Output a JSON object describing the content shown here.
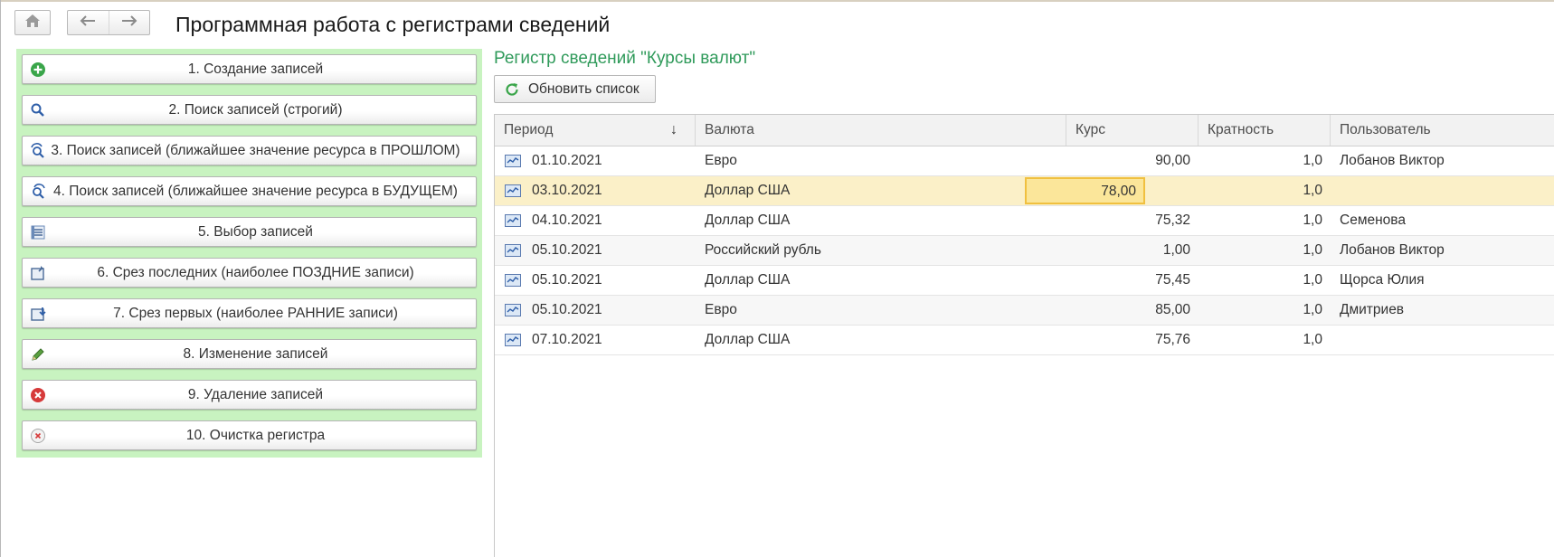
{
  "window": {
    "title": "Программная работа с регистрами сведений"
  },
  "nav": {
    "home_icon": "home-icon",
    "back_icon": "arrow-left-icon",
    "forward_icon": "arrow-right-icon"
  },
  "commands": [
    {
      "label": "1. Создание записей",
      "icon": "add-circle-icon"
    },
    {
      "label": "2. Поиск записей (строгий)",
      "icon": "search-icon"
    },
    {
      "label": "3. Поиск записей (ближайшее значение ресурса в ПРОШЛОМ)",
      "icon": "search-past-icon"
    },
    {
      "label": "4. Поиск записей (ближайшее значение ресурса в БУДУЩЕМ)",
      "icon": "search-future-icon"
    },
    {
      "label": "5. Выбор записей",
      "icon": "select-list-icon"
    },
    {
      "label": "6. Срез последних (наиболее ПОЗДНИЕ записи)",
      "icon": "slice-last-icon"
    },
    {
      "label": "7. Срез первых (наиболее РАННИЕ записи)",
      "icon": "slice-first-icon"
    },
    {
      "label": "8. Изменение записей",
      "icon": "pencil-icon"
    },
    {
      "label": "9. Удаление записей",
      "icon": "delete-circle-icon"
    },
    {
      "label": "10. Очистка регистра",
      "icon": "clear-circle-icon"
    }
  ],
  "register": {
    "title": "Регистр сведений \"Курсы валют\"",
    "refresh_label": "Обновить список",
    "columns": {
      "period": "Период",
      "currency": "Валюта",
      "rate": "Курс",
      "multiplicity": "Кратность",
      "user": "Пользователь"
    },
    "sort_indicator": "↓",
    "rows": [
      {
        "period": "01.10.2021",
        "currency": "Евро",
        "rate": "90,00",
        "multiplicity": "1,0",
        "user": "Лобанов Виктор"
      },
      {
        "period": "03.10.2021",
        "currency": "Доллар США",
        "rate": "78,00",
        "multiplicity": "1,0",
        "user": ""
      },
      {
        "period": "04.10.2021",
        "currency": "Доллар США",
        "rate": "75,32",
        "multiplicity": "1,0",
        "user": "Семенова"
      },
      {
        "period": "05.10.2021",
        "currency": "Российский рубль",
        "rate": "1,00",
        "multiplicity": "1,0",
        "user": "Лобанов Виктор"
      },
      {
        "period": "05.10.2021",
        "currency": "Доллар США",
        "rate": "75,45",
        "multiplicity": "1,0",
        "user": "Щорса Юлия"
      },
      {
        "period": "05.10.2021",
        "currency": "Евро",
        "rate": "85,00",
        "multiplicity": "1,0",
        "user": "Дмитриев"
      },
      {
        "period": "07.10.2021",
        "currency": "Доллар США",
        "rate": "75,76",
        "multiplicity": "1,0",
        "user": ""
      }
    ],
    "selected_row": 2
  },
  "colors": {
    "panel_bg": "#c8f3c0",
    "title_green": "#2f9a5a",
    "selected_row": "#fbf0c8",
    "focused_cell": "#fbe69a"
  }
}
